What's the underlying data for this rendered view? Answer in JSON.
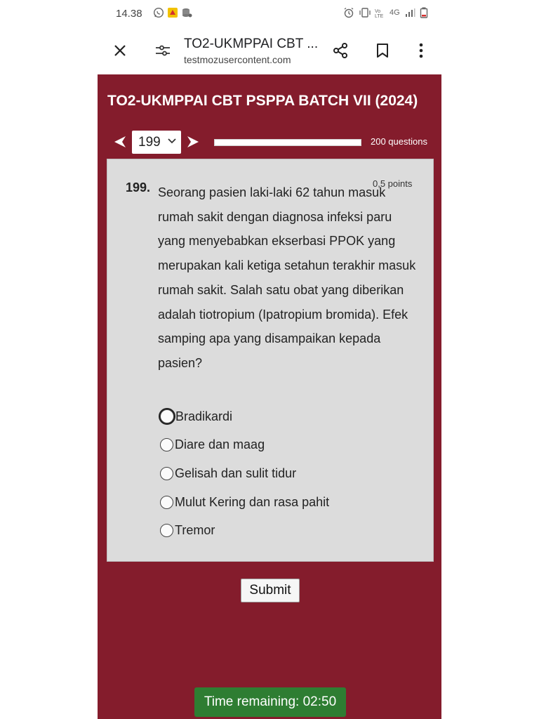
{
  "status_bar": {
    "time": "14.38",
    "left_icons": [
      "whatsapp-icon",
      "notification-app-icon",
      "database-app-icon"
    ],
    "right_icons": [
      "alarm-icon",
      "vibrate-icon",
      "volte-icon",
      "4g-icon",
      "signal-icon",
      "battery-icon"
    ],
    "network_label": "4G"
  },
  "browser": {
    "page_title": "TO2-UKMPPAI CBT ...",
    "url": "testmozusercontent.com"
  },
  "quiz": {
    "title": "TO2-UKMPPAI CBT PSPPA BATCH VII (2024)",
    "current_question": "199",
    "total_label": "200 questions",
    "progress_fraction": 0.995,
    "question": {
      "number": "199.",
      "points": "0,5 points",
      "text": "Seorang pasien laki-laki 62 tahun masuk rumah sakit dengan diagnosa infeksi paru yang menyebabkan ekserbasi PPOK yang merupakan kali ketiga setahun terakhir masuk rumah sakit. Salah satu obat yang diberikan adalah tiotropium (Ipatropium bromida). Efek samping apa yang disampaikan kepada pasien?",
      "options": [
        "Bradikardi",
        "Diare dan maag",
        "Gelisah dan sulit tidur",
        "Mulut Kering dan rasa pahit",
        "Tremor"
      ]
    },
    "submit_label": "Submit",
    "timer_text": "Time remaining: 02:50"
  },
  "colors": {
    "page_bg": "#841c2c",
    "card_bg": "#dcdcdc",
    "timer_bg": "#2e7d32"
  }
}
